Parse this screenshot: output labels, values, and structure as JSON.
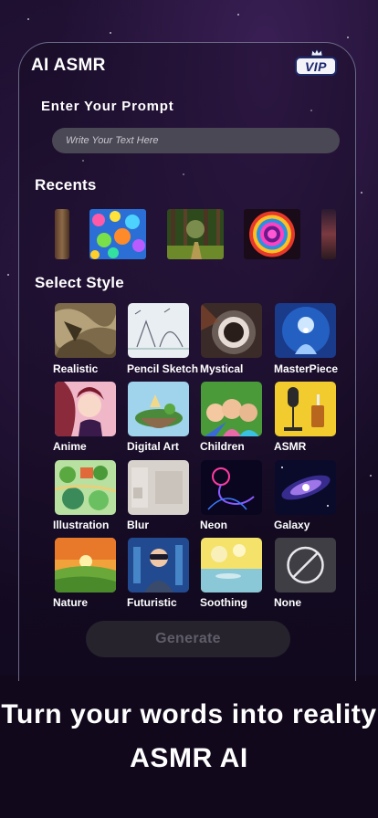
{
  "app": {
    "title": "AI ASMR",
    "vip_label": "VIP"
  },
  "prompt": {
    "label": "Enter Your Prompt",
    "placeholder": "Write Your Text Here",
    "value": ""
  },
  "recents": {
    "title": "Recents",
    "icons": [
      "thumbnail-forest-edge",
      "colorful-bubbles",
      "forest-path",
      "neon-ring",
      "thumbnail-partial"
    ]
  },
  "styles": {
    "title": "Select Style",
    "items": [
      {
        "label": "Realistic"
      },
      {
        "label": "Pencil Sketch"
      },
      {
        "label": "Mystical"
      },
      {
        "label": "MasterPiece"
      },
      {
        "label": "Anime"
      },
      {
        "label": "Digital Art"
      },
      {
        "label": "Children"
      },
      {
        "label": "ASMR"
      },
      {
        "label": "Illustration"
      },
      {
        "label": "Blur"
      },
      {
        "label": "Neon"
      },
      {
        "label": "Galaxy"
      },
      {
        "label": "Nature"
      },
      {
        "label": "Futuristic"
      },
      {
        "label": "Soothing"
      },
      {
        "label": "None"
      }
    ]
  },
  "generate": {
    "label": "Generate"
  },
  "tagline": {
    "line1": "Turn your words into reality",
    "line2": "ASMR AI"
  }
}
